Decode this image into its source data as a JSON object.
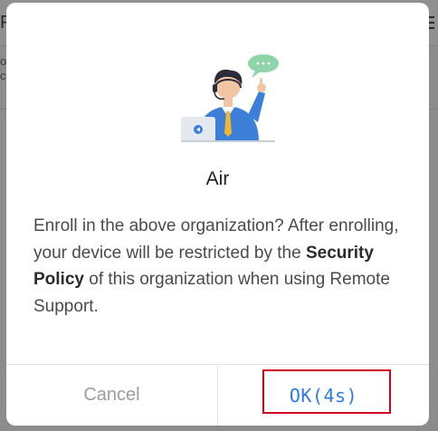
{
  "background": {
    "title_fragment": "F",
    "line_fragment_1": "o",
    "line_fragment_2": "c:"
  },
  "dialog": {
    "illustration_icon": "support-agent-illustration",
    "speech_bubble_text": "···",
    "organization_name": "Air",
    "message": {
      "part1": "Enroll in the above organization? After enrolling, your device will be restricted by the ",
      "emphasis": "Security Policy",
      "part2": " of this organization when using Remote Support."
    },
    "buttons": {
      "cancel_label": "Cancel",
      "ok_label": "OK(4s)"
    },
    "colors": {
      "accent": "#2c7be5",
      "highlight_box": "#d0021b",
      "cancel_text": "#9c9c9c"
    }
  }
}
